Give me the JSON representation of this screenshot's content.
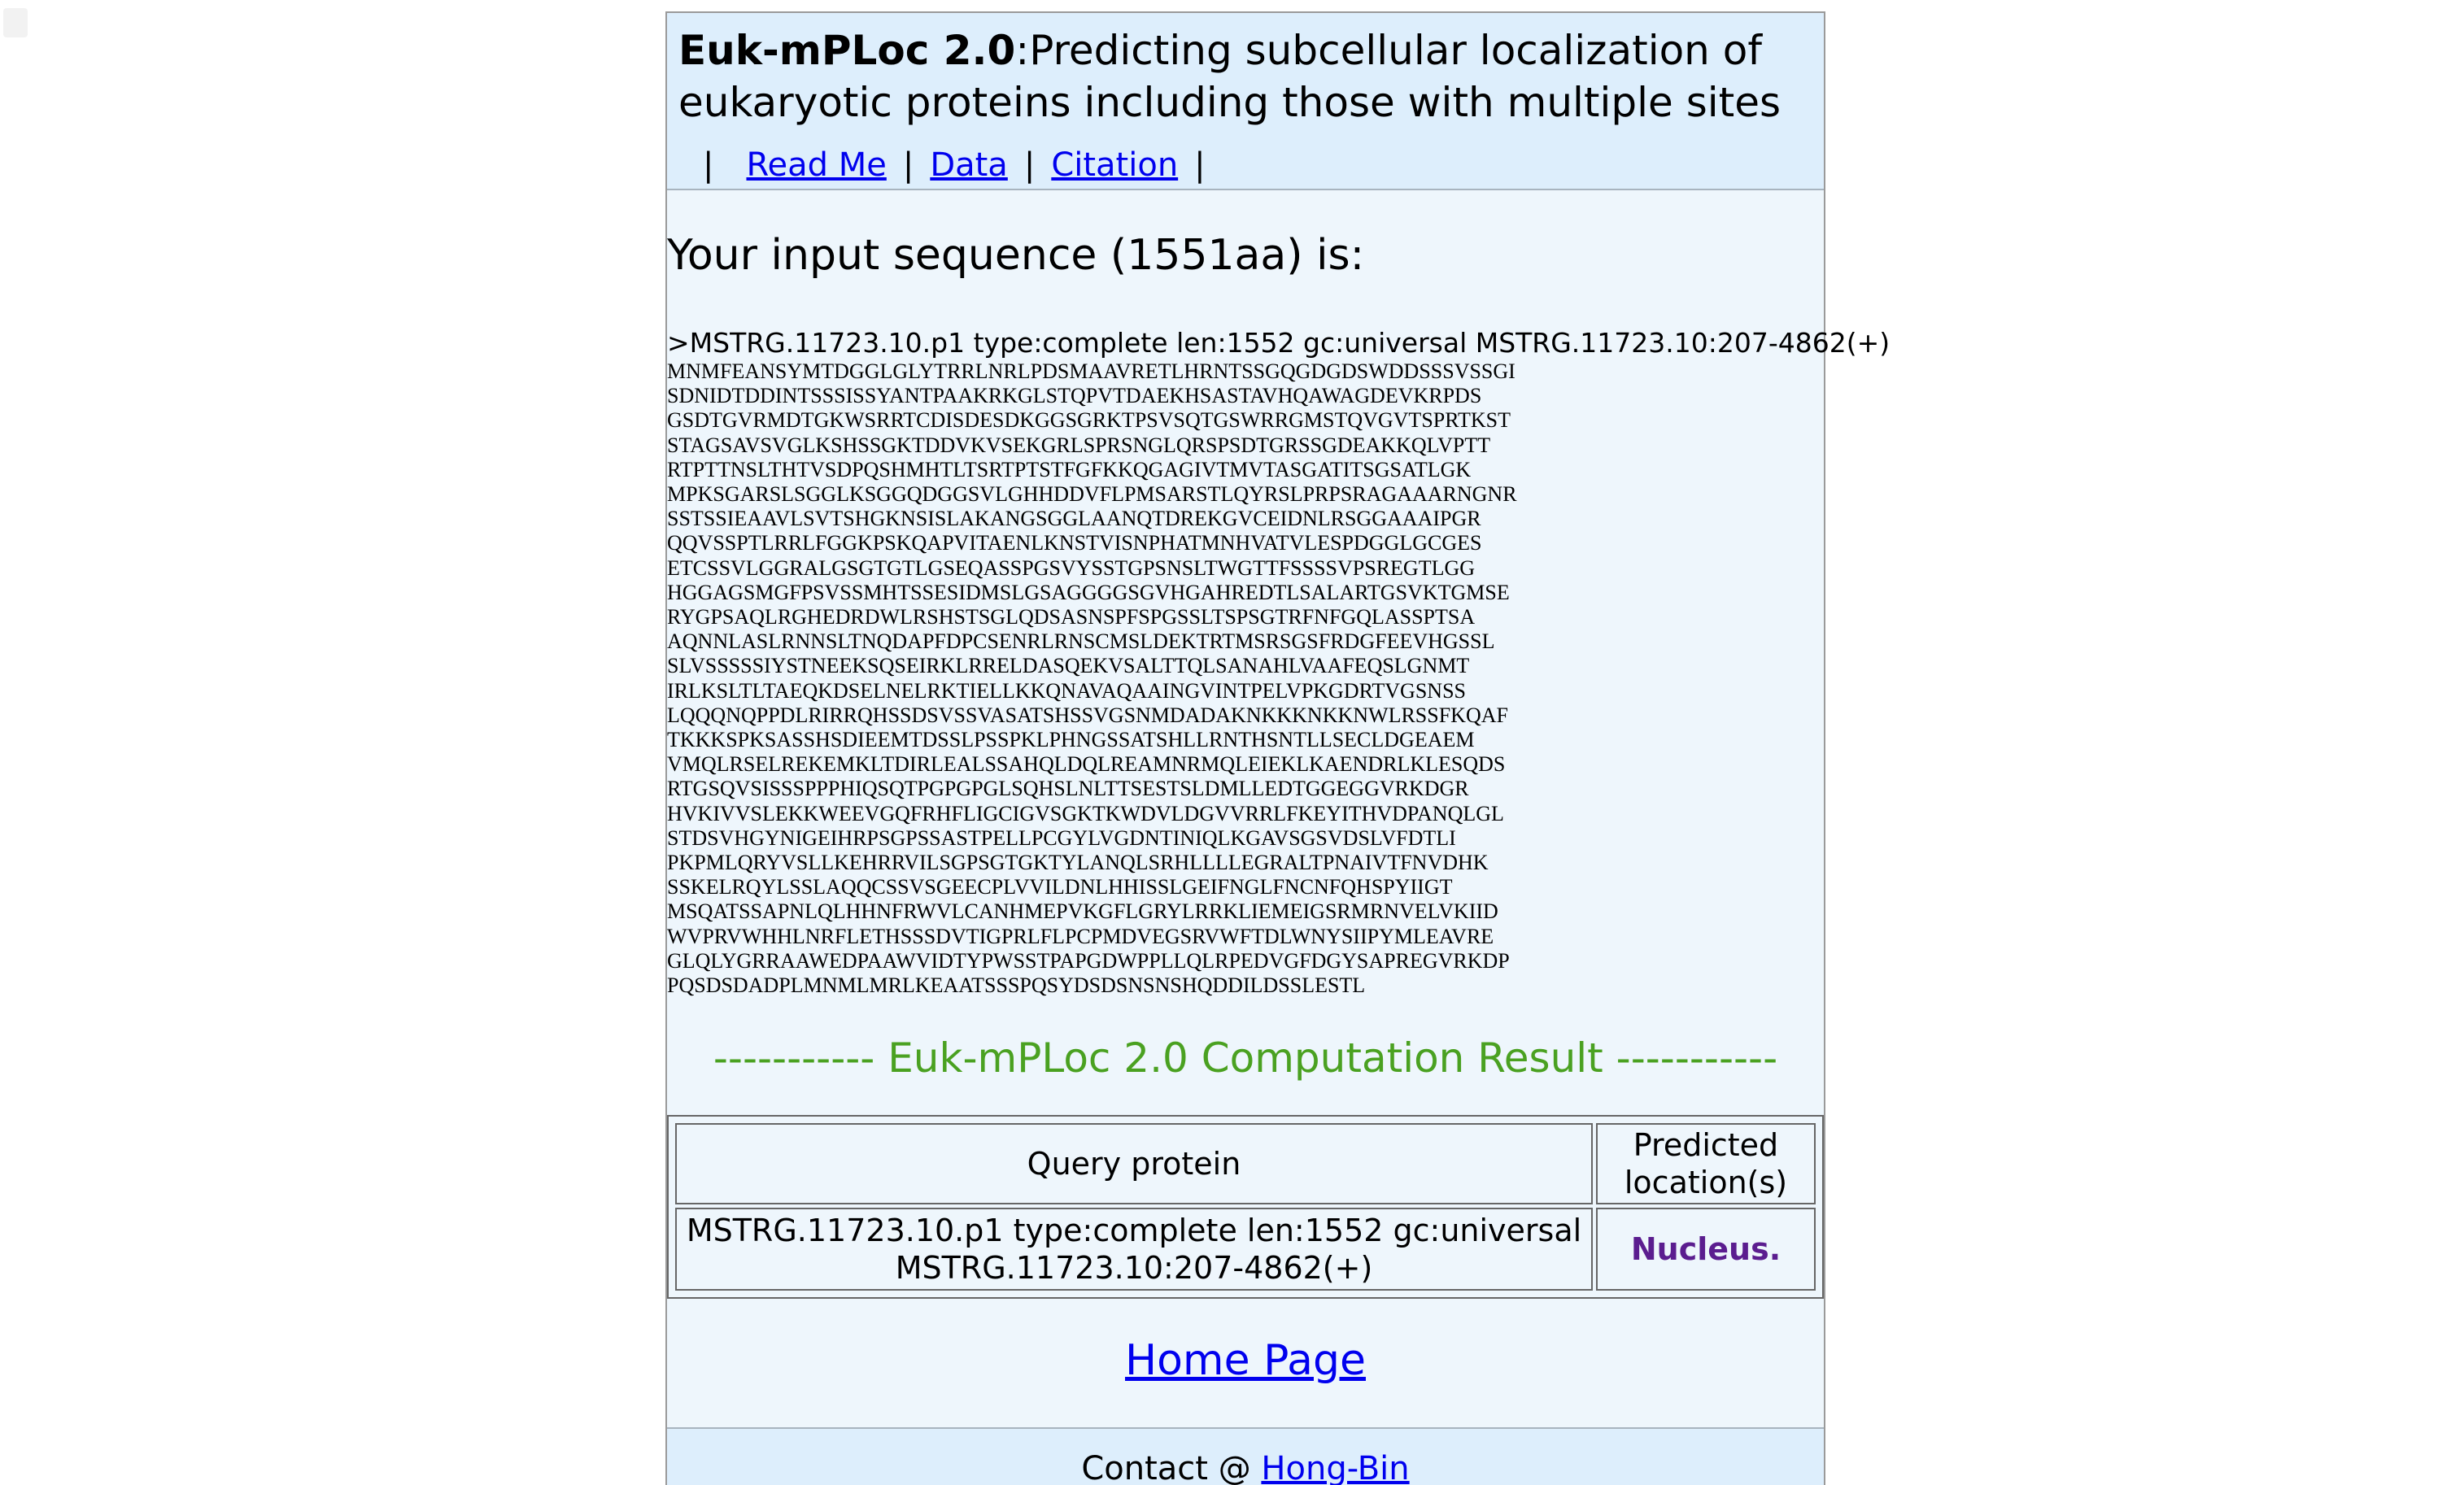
{
  "header": {
    "title_bold": "Euk-mPLoc 2.0",
    "title_rest": ":Predicting subcellular localization of eukaryotic proteins including those with multiple sites",
    "nav": [
      "Read Me",
      "Data",
      "Citation"
    ],
    "nav_sep": "|"
  },
  "main": {
    "intro": "Your input sequence (1551aa) is:",
    "seq_header": ">MSTRG.11723.10.p1 type:complete len:1552 gc:universal MSTRG.11723.10:207-4862(+)",
    "sequence": "MNMFEANSYMTDGGLGLYTRRLNRLPDSMAAVRETLHRNTSSGQGDGDSWDDSSSVSSGI\nSDNIDTDDINTSSSISSYANTPAAKRKGLSTQPVTDAEKHSASTAVHQAWAGDEVKRPDS\nGSDTGVRMDTGKWSRRTCDISDESDKGGSGRKTPSVSQTGSWRRGMSTQVGVTSPRTKST\nSTAGSAVSVGLKSHSSGKTDDVKVSEKGRLSPRSNGLQRSPSDTGRSSGDEAKKQLVPTT\nRTPTTNSLTHTVSDPQSHMHTLTSRTPTSTFGFKKQGAGIVTMVTASGATITSGSATLGK\nMPKSGARSLSGGLKSGGQDGGSVLGHHDDVFLPMSARSTLQYRSLPRPSRAGAAARNGNR\nSSTSSIEAAVLSVTSHGKNSISLAKANGSGGLAANQTDREKGVCEIDNLRSGGAAAIPGR\nQQVSSPTLRRLFGGKPSKQAPVITAENLKNSTVISNPHATMNHVATVLESPDGGLGCGES\nETCSSVLGGRALGSGTGTLGSEQASSPGSVYSSTGPSNSLTWGTTFSSSSVPSREGTLGG\nHGGAGSMGFPSVSSMHTSSESIDMSLGSAGGGGSGVHGAHREDTLSALARTGSVKTGMSE\nRYGPSAQLRGHEDRDWLRSHSTSGLQDSASNSPFSPGSSLTSPSGTRFNFGQLASSPTSA\nAQNNLASLRNNSLTNQDAPFDPCSENRLRNSCMSLDEKTRTMSRSGSFRDGFEEVHGSSL\nSLVSSSSSIYSTNEEKSQSEIRKLRRELDASQEKVSALTTQLSANAHLVAAFEQSLGNMT\nIRLKSLTLTAEQKDSELNELRKTIELLKKQNAVAQAAINGVINTPELVPKGDRTVGSNSS\nLQQQNQPPDLRIRRQHSSDSVSSVASATSHSSVGSNMDADAKNKKKNKKNWLRSSFKQAF\nTKKKSPKSASSHSDIEEMTDSSLPSSPKLPHNGSSATSHLLRNTHSNTLLSECLDGEAEM\nVMQLRSELREKEMKLTDIRLEALSSAHQLDQLREAMNRMQLEIEKLKAENDRLKLESQDS\nRTGSQVSISSSPPPHIQSQTPGPGPGLSQHSLNLTTSESTSLDMLLEDTGGEGGVRKDGR\nHVKIVVSLEKKWEEVGQFRHFLIGCIGVSGKTKWDVLDGVVRRLFKEYITHVDPANQLGL\nSTDSVHGYNIGEIHRPSGPSSASTPELLPCGYLVGDNTINIQLKGAVSGSVDSLVFDTLI\nPKPMLQRYVSLLKEHRRVILSGPSGTGKTYLANQLSRHLLLLEGRALTPNAIVTFNVDHK\nSSKELRQYLSSLAQQCSSVSGEECPLVVILDNLHHISSLGEIFNGLFNCNFQHSPYIIGT\nMSQATSSAPNLQLHHNFRWVLCANHMEPVKGFLGRYLRRKLIEMEIGSRMRNVELVKIID\nWVPRVWHHLNRFLETHSSSDVTIGPRLFLPCPMDVEGSRVWFTDLWNYSIIPYMLEAVRE\nGLQLYGRRAAWEDPAAWVIDTYPWSSTPAPGDWPPLLQLRPEDVGFDGYSAPREGVRKDP\nPQSDSDADPLMNMLMRLKEAATSSSPQSYDSDSNSNSHQDDILDSSLESTL"
  },
  "result": {
    "title": "----------- Euk-mPLoc 2.0 Computation Result -----------",
    "col_query": "Query protein",
    "col_location": "Predicted location(s)",
    "query_value": "MSTRG.11723.10.p1 type:complete len:1552 gc:universal MSTRG.11723.10:207-4862(+)",
    "location_value": "Nucleus."
  },
  "home_link": "Home Page",
  "footer": {
    "contact_prefix": "Contact @",
    "contact_link": "Hong-Bin"
  }
}
